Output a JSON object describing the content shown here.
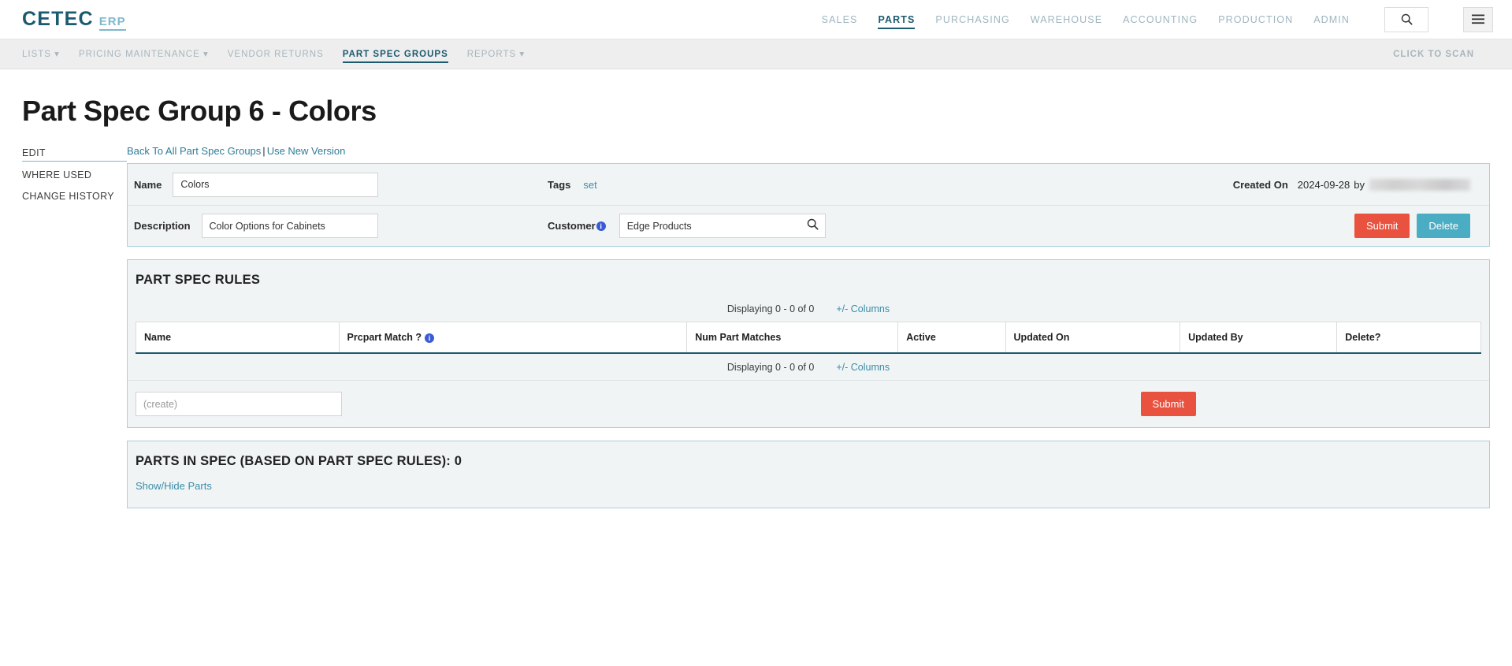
{
  "header": {
    "logo_main": "CETEC",
    "logo_sub": "ERP",
    "nav": [
      {
        "label": "SALES",
        "active": false
      },
      {
        "label": "PARTS",
        "active": true
      },
      {
        "label": "PURCHASING",
        "active": false
      },
      {
        "label": "WAREHOUSE",
        "active": false
      },
      {
        "label": "ACCOUNTING",
        "active": false
      },
      {
        "label": "PRODUCTION",
        "active": false
      },
      {
        "label": "ADMIN",
        "active": false
      }
    ],
    "search_icon": "search-icon",
    "menu_icon": "hamburger-menu-icon"
  },
  "subnav": {
    "items": [
      {
        "label": "LISTS",
        "caret": "▾",
        "active": false
      },
      {
        "label": "PRICING MAINTENANCE",
        "caret": "▾",
        "active": false
      },
      {
        "label": "VENDOR RETURNS",
        "caret": "",
        "active": false
      },
      {
        "label": "PART SPEC GROUPS",
        "caret": "",
        "active": true
      },
      {
        "label": "REPORTS",
        "caret": "▾",
        "active": false
      }
    ],
    "scan_label": "CLICK TO SCAN"
  },
  "page": {
    "title": "Part Spec Group 6 - Colors"
  },
  "side_menu": {
    "items": [
      {
        "label": "EDIT",
        "active": true
      },
      {
        "label": "WHERE USED",
        "active": false
      },
      {
        "label": "CHANGE HISTORY",
        "active": false
      }
    ]
  },
  "breadcrumb": {
    "back_link": "Back To All Part Spec Groups",
    "separator": "|",
    "new_version_link": "Use New Version"
  },
  "info_form": {
    "name_label": "Name",
    "name_value": "Colors",
    "description_label": "Description",
    "description_value": "Color Options for Cabinets",
    "tags_label": "Tags",
    "tags_set_link": "set",
    "customer_label": "Customer",
    "customer_value": "Edge Products",
    "customer_search_icon": "search-icon",
    "customer_info_icon": "info-icon",
    "created_on_label": "Created On",
    "created_on_value": "2024-09-28",
    "created_by_prefix": "by",
    "created_by_value": "",
    "submit_label": "Submit",
    "delete_label": "Delete"
  },
  "rules_section": {
    "title": "PART SPEC RULES",
    "displaying_top": "Displaying 0 - 0 of 0",
    "columns_link_top": "+/- Columns",
    "displaying_bottom": "Displaying 0 - 0 of 0",
    "columns_link_bottom": "+/- Columns",
    "columns": [
      {
        "label": "Name",
        "info": false
      },
      {
        "label": "Prcpart Match ?",
        "info": true
      },
      {
        "label": "Num Part Matches",
        "info": false
      },
      {
        "label": "Active",
        "info": false
      },
      {
        "label": "Updated On",
        "info": false
      },
      {
        "label": "Updated By",
        "info": false
      },
      {
        "label": "Delete?",
        "info": false
      }
    ],
    "rows": [],
    "create_placeholder": "(create)",
    "create_submit_label": "Submit"
  },
  "spec_section": {
    "title": "PARTS IN SPEC (BASED ON PART SPEC RULES): 0",
    "show_hide_link": "Show/Hide Parts"
  },
  "colors": {
    "brand_dark": "#1c5a70",
    "brand_light": "#7fb8cc",
    "panel_bg": "#f0f4f5",
    "panel_border": "#a9cfdd",
    "link": "#3b8da8",
    "submit_red": "#e8523f",
    "delete_teal": "#4aadc4",
    "info_blue": "#3b5bd6"
  }
}
